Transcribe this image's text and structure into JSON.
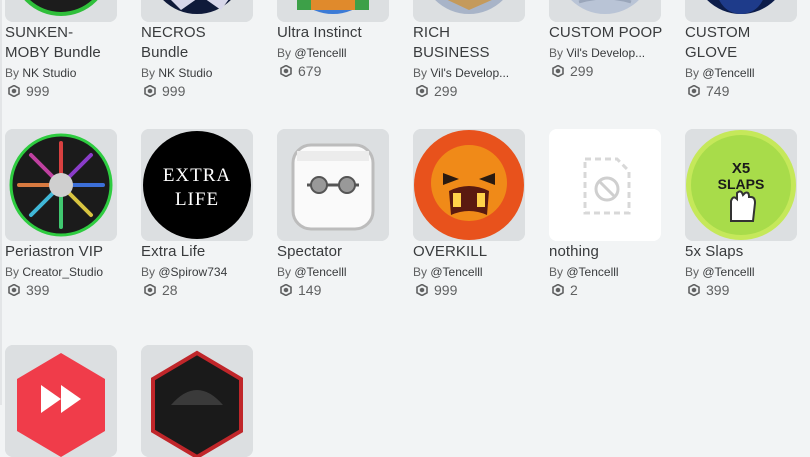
{
  "by_prefix": "By",
  "items": [
    {
      "title": "SUNKEN-\nMOBY Bundle",
      "creator": "NK Studio",
      "price": "999"
    },
    {
      "title": "NECROS Bundle",
      "creator": "NK Studio",
      "price": "999"
    },
    {
      "title": "Ultra Instinct",
      "creator": "@Tencelll",
      "price": "679"
    },
    {
      "title": "RICH BUSINESS",
      "creator": "Vil's Develop...",
      "price": "299"
    },
    {
      "title": "CUSTOM POOP",
      "creator": "Vil's Develop...",
      "price": "299"
    },
    {
      "title": "CUSTOM GLOVE",
      "creator": "@Tencelll",
      "price": "749"
    },
    {
      "title": "Periastron VIP",
      "creator": "Creator_Studio",
      "price": "399"
    },
    {
      "title": "Extra Life",
      "creator": "@Spirow734",
      "price": "28"
    },
    {
      "title": "Spectator",
      "creator": "@Tencelll",
      "price": "149"
    },
    {
      "title": "OVERKILL",
      "creator": "@Tencelll",
      "price": "999"
    },
    {
      "title": "nothing",
      "creator": "@Tencelll",
      "price": "2"
    },
    {
      "title": "5x Slaps",
      "creator": "@Tencelll",
      "price": "399"
    }
  ],
  "thumb_text": {
    "extra_life": "EXTRA\nLIFE",
    "five_x_slaps": "X5\nSLAPS"
  },
  "icons": {
    "robux": "robux-icon",
    "broken_image": "broken-image-icon",
    "fast_forward": "fast-forward-icon"
  }
}
